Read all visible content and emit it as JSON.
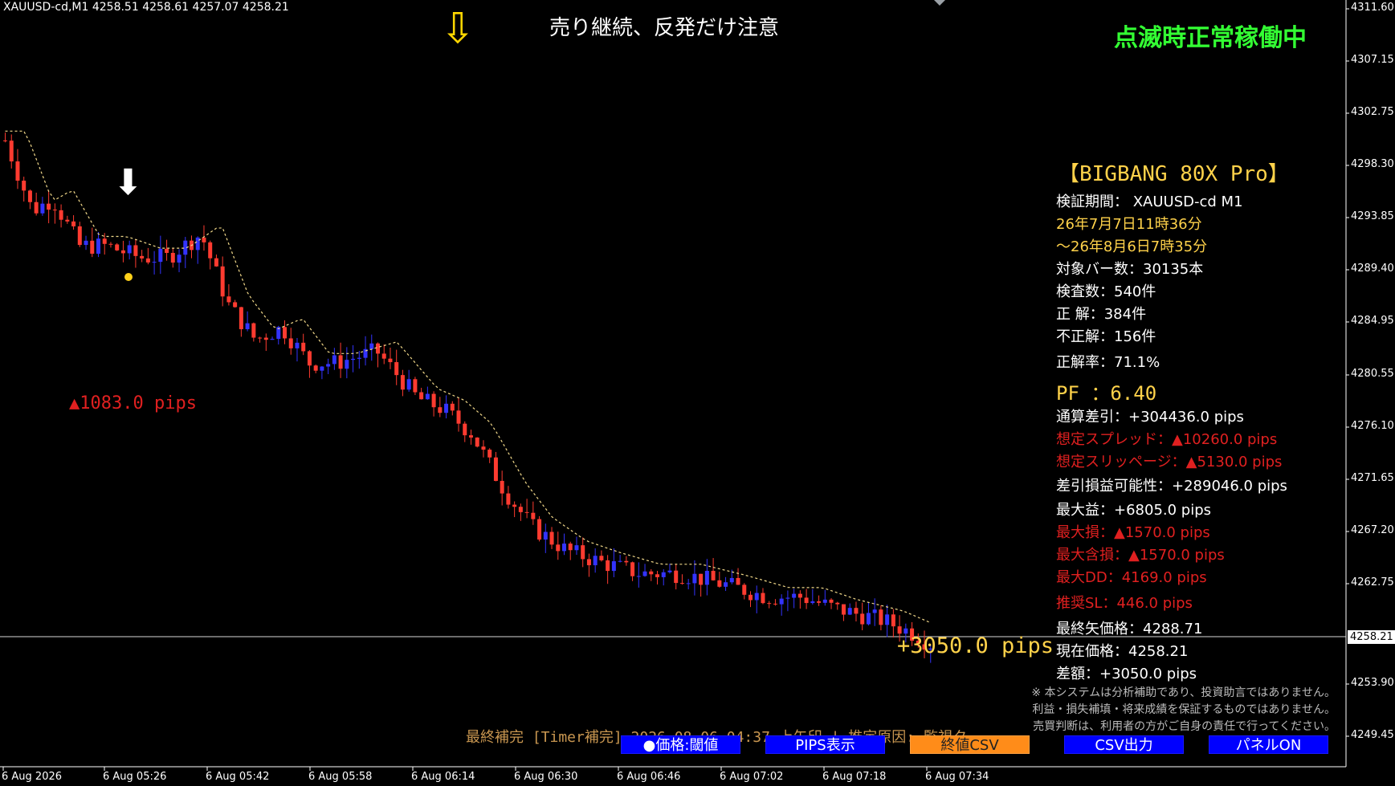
{
  "header": {
    "symbol_info": "XAUUSD-cd,M1  4258.51 4258.61 4257.07 4258.21"
  },
  "notice": {
    "arrow_glyph": "⇩",
    "text": "売り継続、反発だけ注意"
  },
  "status_text": "点滅時正常稼働中",
  "signal_arrow_glyph": "⬇",
  "left_loss_label": "▲1083.0 pips",
  "current_profit_label": "+3050.0 pips",
  "panel": {
    "title": "【BIGBANG 80X Pro】",
    "rows": [
      {
        "text": "検証期間：  XAUUSD-cd M1",
        "color": "#ffffff"
      },
      {
        "text": "26年7月7日11時36分",
        "color": "#ffd24a"
      },
      {
        "text": "～26年8月6日7時35分",
        "color": "#ffd24a"
      },
      {
        "text": "対象バー数：30135本",
        "color": "#ffffff"
      },
      {
        "text": "検査数：540件",
        "color": "#ffffff"
      },
      {
        "text": "正  解：384件",
        "color": "#ffffff"
      },
      {
        "text": "不正解：156件",
        "color": "#ffffff"
      },
      {
        "text": "正解率：71.1%",
        "color": "#ffffff"
      }
    ],
    "pf": " PF  ：6.40",
    "rows2": [
      {
        "text": "通算差引：+304436.0 pips",
        "color": "#ffffff"
      },
      {
        "text": "想定スプレッド：▲10260.0 pips",
        "color": "#e02020"
      },
      {
        "text": "想定スリッページ：▲5130.0 pips",
        "color": "#e02020"
      },
      {
        "text": "差引損益可能性：+289046.0 pips",
        "color": "#ffffff"
      },
      {
        "text": "最大益：+6805.0 pips",
        "color": "#ffffff"
      },
      {
        "text": "最大損：▲1570.0 pips",
        "color": "#e02020"
      },
      {
        "text": "最大含損：▲1570.0 pips",
        "color": "#e02020"
      },
      {
        "text": "最大DD：4169.0 pips",
        "color": "#e02020"
      },
      {
        "text": "推奨SL：446.0 pips",
        "color": "#e02020"
      },
      {
        "text": "最終矢価格：4288.71",
        "color": "#ffffff"
      },
      {
        "text": "現在価格：4258.21",
        "color": "#ffffff"
      },
      {
        "text": "差額：+3050.0 pips",
        "color": "#ffffff"
      }
    ]
  },
  "disclaimer": [
    "※ 本システムは分析補助であり、投資助言ではありません。",
    "利益・損失補填・将来成績を保証するものではありません。",
    "売買判断は、利用者の方がご自身の責任で行ってください。"
  ],
  "last_fix": "最終補完 [Timer補完] 2026.08.06 04:37 上矢印 | 推定原因: 監視タ",
  "buttons": [
    {
      "label": "●価格:閾値",
      "style": "blue"
    },
    {
      "label": "PIPS表示",
      "style": "blue"
    },
    {
      "label": "終値CSV",
      "style": "orange"
    },
    {
      "label": "CSV出力",
      "style": "blue"
    },
    {
      "label": "パネルON",
      "style": "blue"
    }
  ],
  "y_axis_ticks": [
    "4311.60",
    "4307.15",
    "4302.75",
    "4298.30",
    "4293.85",
    "4289.40",
    "4284.95",
    "4280.55",
    "4276.10",
    "4271.65",
    "4267.20",
    "4262.75",
    "4258.21",
    "4253.90",
    "4249.45"
  ],
  "current_price_tag": "4258.21",
  "x_axis_ticks": [
    "6 Aug 2026",
    "6 Aug 05:26",
    "6 Aug 05:42",
    "6 Aug 05:58",
    "6 Aug 06:14",
    "6 Aug 06:30",
    "6 Aug 06:46",
    "6 Aug 07:02",
    "6 Aug 07:18",
    "6 Aug 07:34"
  ],
  "colors": {
    "bull": "#3333ff",
    "bear": "#ff3b30",
    "ma": "#f2d98a",
    "grid": "#ffffff"
  },
  "chart_data": {
    "type": "candlestick",
    "symbol": "XAUUSD-cd",
    "timeframe": "M1",
    "ylim": [
      4247.5,
      4313.0
    ],
    "current_price": 4258.21,
    "path_points": [
      [
        0,
        4301
      ],
      [
        8,
        4295
      ],
      [
        14,
        4296
      ],
      [
        22,
        4292
      ],
      [
        30,
        4292
      ],
      [
        40,
        4291
      ],
      [
        48,
        4291
      ],
      [
        58,
        4293
      ],
      [
        66,
        4287
      ],
      [
        74,
        4284
      ],
      [
        82,
        4285
      ],
      [
        90,
        4282
      ],
      [
        98,
        4282
      ],
      [
        110,
        4283
      ],
      [
        122,
        4279
      ],
      [
        130,
        4278
      ],
      [
        138,
        4276
      ],
      [
        148,
        4271
      ],
      [
        156,
        4268
      ],
      [
        166,
        4266
      ],
      [
        176,
        4265
      ],
      [
        188,
        4264
      ],
      [
        200,
        4264
      ],
      [
        214,
        4263
      ],
      [
        226,
        4262
      ],
      [
        236,
        4262
      ],
      [
        246,
        4261
      ],
      [
        260,
        4260
      ],
      [
        268,
        4259
      ],
      [
        274,
        4258
      ]
    ],
    "notes": "approximate close path used to render bars"
  }
}
